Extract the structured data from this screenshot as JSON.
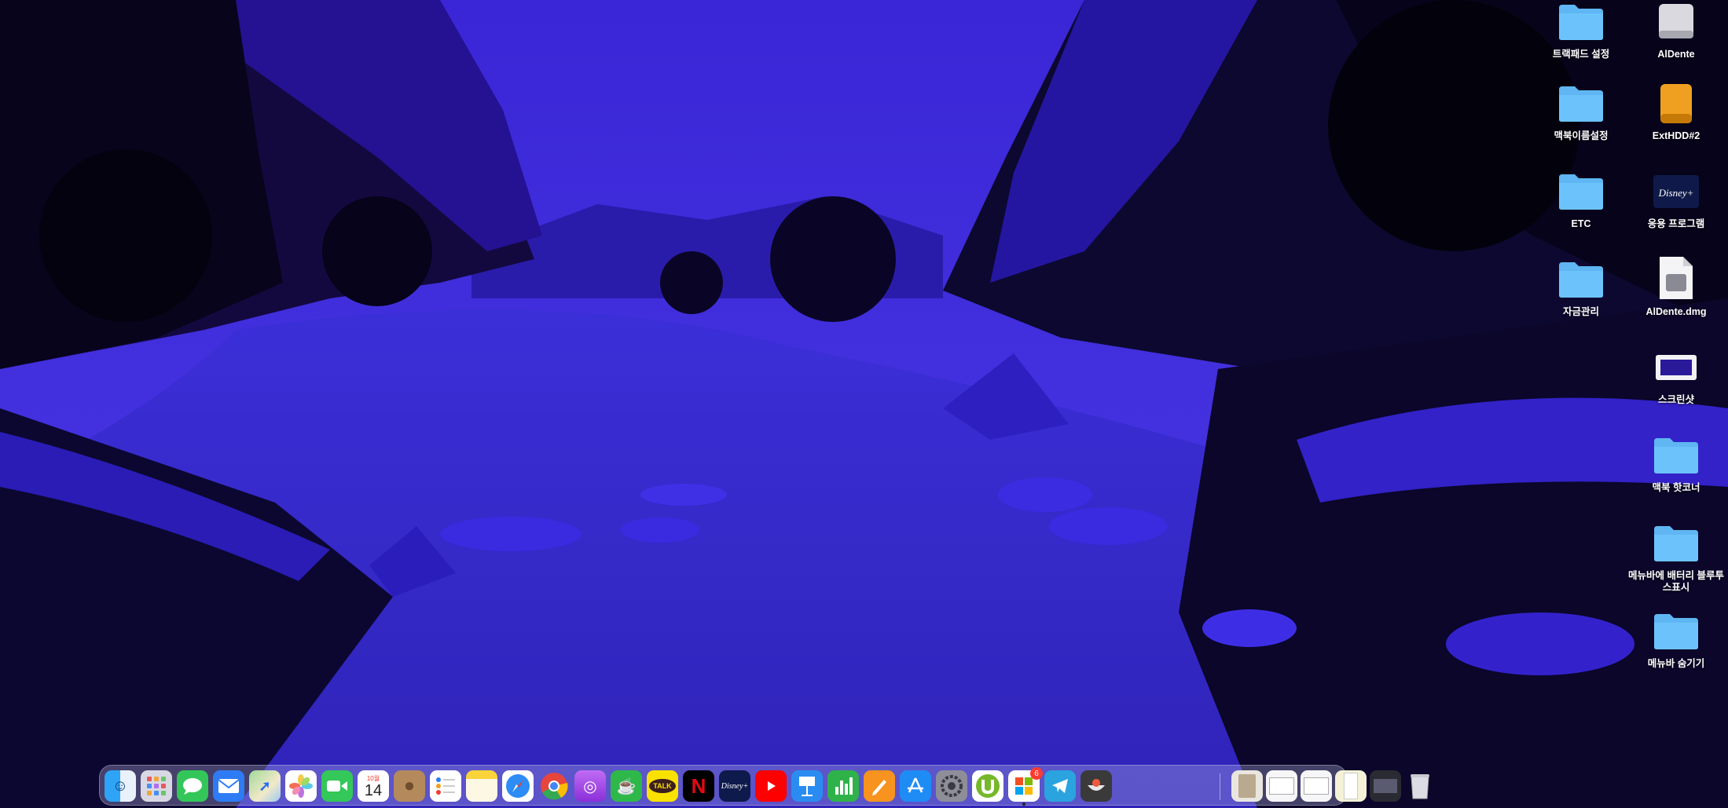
{
  "desktop_icons": [
    {
      "label": "트랙패드 설정",
      "icon": "folder-icon"
    },
    {
      "label": "AlDente",
      "icon": "disk-drive-icon"
    },
    {
      "label": "맥북이름설정",
      "icon": "folder-icon"
    },
    {
      "label": "ExtHDD#2",
      "icon": "external-drive-icon"
    },
    {
      "label": "ETC",
      "icon": "folder-icon"
    },
    {
      "label": "응용 프로그램",
      "icon": "disney-plus-app-icon"
    },
    {
      "label": "자금관리",
      "icon": "folder-icon"
    },
    {
      "label": "AlDente.dmg",
      "icon": "dmg-file-icon"
    },
    {
      "label": "스크린샷",
      "icon": "screenshot-icon"
    },
    {
      "label": "맥북 핫코너",
      "icon": "folder-icon"
    },
    {
      "label": "메뉴바에 배터리 블루투스표시",
      "icon": "folder-icon"
    },
    {
      "label": "메뉴바 숨기기",
      "icon": "folder-icon"
    }
  ],
  "dock": {
    "apps": [
      {
        "name": "Finder",
        "icon": "finder-icon",
        "running": true
      },
      {
        "name": "Launchpad",
        "icon": "launchpad-icon",
        "running": false
      },
      {
        "name": "Messages",
        "icon": "messages-icon",
        "running": false
      },
      {
        "name": "Mail",
        "icon": "mail-icon",
        "running": false
      },
      {
        "name": "Maps",
        "icon": "maps-icon",
        "running": false
      },
      {
        "name": "Photos",
        "icon": "photos-icon",
        "running": false
      },
      {
        "name": "FaceTime",
        "icon": "facetime-icon",
        "running": false
      },
      {
        "name": "Calendar",
        "icon": "calendar-icon",
        "running": false,
        "month": "10월",
        "day": "14"
      },
      {
        "name": "Contacts",
        "icon": "contacts-icon",
        "running": false
      },
      {
        "name": "Reminders",
        "icon": "reminders-icon",
        "running": false
      },
      {
        "name": "Notes",
        "icon": "notes-icon",
        "running": true
      },
      {
        "name": "Safari",
        "icon": "safari-icon",
        "running": true
      },
      {
        "name": "Chrome",
        "icon": "chrome-icon",
        "running": true
      },
      {
        "name": "Podcasts",
        "icon": "podcasts-icon",
        "running": false
      },
      {
        "name": "KakaoTalk Cafe",
        "icon": "coffee-cup-icon",
        "running": false
      },
      {
        "name": "KakaoTalk",
        "icon": "kakaotalk-icon",
        "running": true,
        "text": "TALK"
      },
      {
        "name": "Netflix",
        "icon": "netflix-icon",
        "running": false,
        "text": "N"
      },
      {
        "name": "Disney+",
        "icon": "disney-plus-icon",
        "running": false,
        "text": "Disney+"
      },
      {
        "name": "YouTube",
        "icon": "youtube-icon",
        "running": false
      },
      {
        "name": "Keynote",
        "icon": "keynote-icon",
        "running": false
      },
      {
        "name": "Numbers",
        "icon": "numbers-icon",
        "running": false
      },
      {
        "name": "Pages",
        "icon": "pages-icon",
        "running": false
      },
      {
        "name": "App Store",
        "icon": "app-store-icon",
        "running": false
      },
      {
        "name": "System Preferences",
        "icon": "system-preferences-icon",
        "running": false
      },
      {
        "name": "uTorrent",
        "icon": "utorrent-icon",
        "running": false
      },
      {
        "name": "Microsoft",
        "icon": "microsoft-icon",
        "running": true,
        "badge": "6"
      },
      {
        "name": "Telegram",
        "icon": "telegram-icon",
        "running": true
      },
      {
        "name": "Miscellaneous App",
        "icon": "bowl-icon",
        "running": true
      }
    ],
    "recent_items": [
      {
        "name": "Document 1",
        "icon": "document-thumbnail-icon"
      },
      {
        "name": "Screenshot 1",
        "icon": "screenshot-thumbnail-icon"
      },
      {
        "name": "Screenshot 2",
        "icon": "screenshot-thumbnail-icon"
      },
      {
        "name": "Document 2",
        "icon": "document-thumbnail-icon"
      },
      {
        "name": "Screenshot 3",
        "icon": "screenshot-thumbnail-icon"
      },
      {
        "name": "Trash",
        "icon": "trash-icon"
      }
    ]
  },
  "colors": {
    "sky": "#3d2ddb",
    "water": "#3a30d8",
    "mountain_dark": "#0d0828",
    "folder": "#5fb6f3"
  }
}
